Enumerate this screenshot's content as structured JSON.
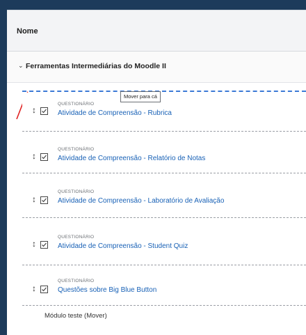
{
  "header": {
    "title": "Nome"
  },
  "section": {
    "title": "Ferramentas Intermediárias do Moodle II"
  },
  "tooltip": "Mover para cá",
  "items": [
    {
      "type": "QUESTIONÁRIO",
      "name": "Atividade de Compreensão - Rubrica"
    },
    {
      "type": "QUESTIONÁRIO",
      "name": "Atividade de Compreensão - Relatório de Notas"
    },
    {
      "type": "QUESTIONÁRIO",
      "name": "Atividade de Compreensão - Laboratório de Avaliação"
    },
    {
      "type": "QUESTIONÁRIO",
      "name": "Atividade de Compreensão - Student Quiz"
    },
    {
      "type": "QUESTIONÁRIO",
      "name": "Questões sobre Big Blue Button"
    }
  ],
  "footer": {
    "text": "Módulo teste (Mover)"
  },
  "colors": {
    "link": "#1861b6",
    "drop_line": "#3b79d6",
    "arrow": "#e02020"
  }
}
